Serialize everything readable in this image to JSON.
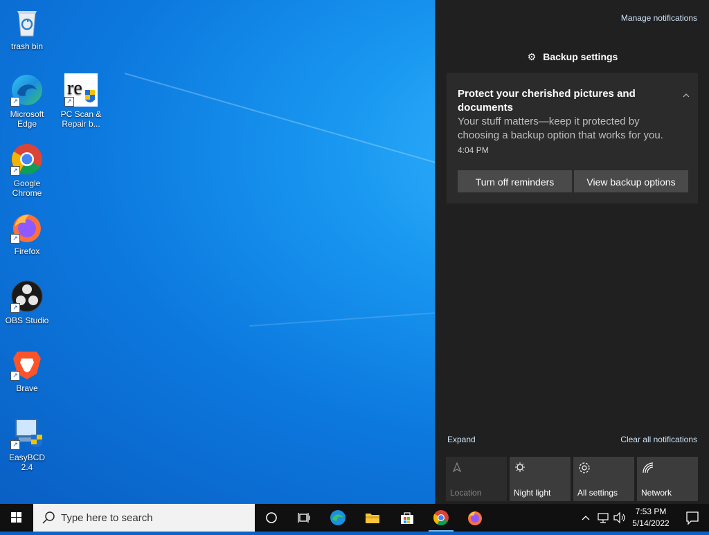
{
  "desktop": {
    "icons": [
      {
        "label": "trash bin",
        "icon": "recycle-bin-icon"
      },
      {
        "label": "Microsoft Edge",
        "icon": "edge-icon"
      },
      {
        "label": "PC Scan & Repair b...",
        "icon": "pc-scan-repair-icon"
      },
      {
        "label": "Google Chrome",
        "icon": "chrome-icon"
      },
      {
        "label": "Firefox",
        "icon": "firefox-icon"
      },
      {
        "label": "OBS Studio",
        "icon": "obs-icon"
      },
      {
        "label": "Brave",
        "icon": "brave-icon"
      },
      {
        "label": "EasyBCD 2.4",
        "icon": "easybcd-icon"
      }
    ]
  },
  "action_center": {
    "manage_link": "Manage notifications",
    "group_header": "Backup settings",
    "toast": {
      "title": "Protect your cherished pictures and documents",
      "body": "Your stuff matters—keep it protected by choosing a backup option that works for you.",
      "time": "4:04 PM",
      "button_off": "Turn off reminders",
      "button_view": "View backup options"
    },
    "expand": "Expand",
    "clear_all": "Clear all notifications",
    "quick_actions": [
      {
        "label": "Location",
        "icon": "location-icon",
        "enabled": false
      },
      {
        "label": "Night light",
        "icon": "night-light-icon",
        "enabled": true
      },
      {
        "label": "All settings",
        "icon": "gear-icon",
        "enabled": true
      },
      {
        "label": "Network",
        "icon": "network-icon",
        "enabled": true
      }
    ]
  },
  "taskbar": {
    "search_placeholder": "Type here to search",
    "time": "7:53 PM",
    "date": "5/14/2022",
    "pinned": [
      "cortana-icon",
      "task-view-icon",
      "edge-icon",
      "file-explorer-icon",
      "store-icon",
      "chrome-icon",
      "firefox-icon"
    ]
  },
  "colors": {
    "accent": "#76b9ed",
    "panel": "#202020",
    "toast": "#2b2b2b",
    "button": "#4a4a4a",
    "link": "#cde3f7"
  }
}
